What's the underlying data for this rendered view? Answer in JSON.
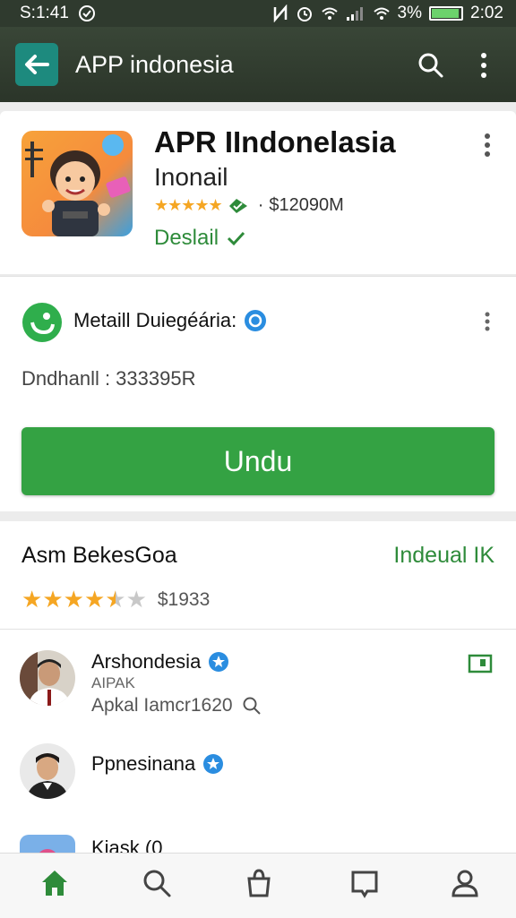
{
  "status_bar": {
    "time_left": "S:1:41",
    "battery": "3%",
    "time_right": "2:02"
  },
  "app_bar": {
    "title": "APP indonesia"
  },
  "app": {
    "name": "APR IIndonelasia",
    "subtitle": "Inonail",
    "size": "$12090M",
    "installed_label": "Deslail",
    "rating": 4.5
  },
  "developer": {
    "name": "Metaill Duiegéária:",
    "downloads": "Dndhanll : 333395R",
    "install_label": "Undu"
  },
  "reviews": {
    "title": "Asm BekesGoa",
    "link": "Indeual IK",
    "rating": 4.5,
    "count": "$1933",
    "items": [
      {
        "name": "Arshondesia",
        "small": "AIPAK",
        "line": "Apkal Iamcr1620"
      },
      {
        "name": "Ppnesinana"
      },
      {
        "name": "Kiask (0"
      }
    ]
  },
  "colors": {
    "accent_green": "#34a243",
    "app_bar": "#2f3a2e",
    "star": "#f5a623"
  }
}
